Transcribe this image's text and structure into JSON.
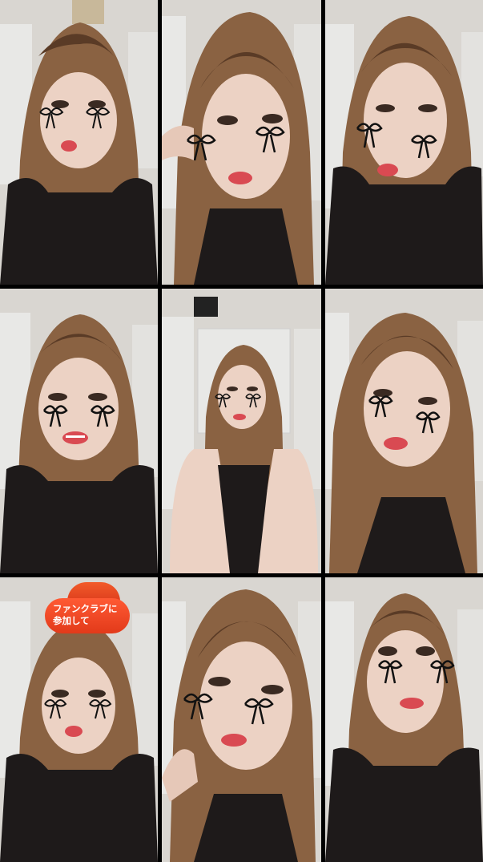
{
  "grid": {
    "rows": 3,
    "columns": 3
  },
  "palette": {
    "hair": "#8a6242",
    "hair_dark": "#5a3b26",
    "skin": "#ecd2c4",
    "lips": "#d94a52",
    "ribbon": "#111111",
    "background_wall": "#d9d6d1",
    "locker": "#e8e8e6",
    "badge": "#ef4a28"
  },
  "tiles": [
    {
      "index": 1,
      "icon": "portrait-ribbon-sticker-icon"
    },
    {
      "index": 2,
      "icon": "portrait-ribbon-sticker-icon"
    },
    {
      "index": 3,
      "icon": "portrait-ribbon-sticker-icon"
    },
    {
      "index": 4,
      "icon": "portrait-ribbon-sticker-icon"
    },
    {
      "index": 5,
      "icon": "portrait-ribbon-sticker-icon"
    },
    {
      "index": 6,
      "icon": "portrait-ribbon-sticker-icon"
    },
    {
      "index": 7,
      "icon": "portrait-ribbon-sticker-icon",
      "badge": "join-fanclub-badge"
    },
    {
      "index": 8,
      "icon": "portrait-ribbon-sticker-icon"
    },
    {
      "index": 9,
      "icon": "portrait-ribbon-sticker-icon"
    }
  ],
  "fanclub_badge": {
    "label": "ファンクラブに\n参加して"
  }
}
